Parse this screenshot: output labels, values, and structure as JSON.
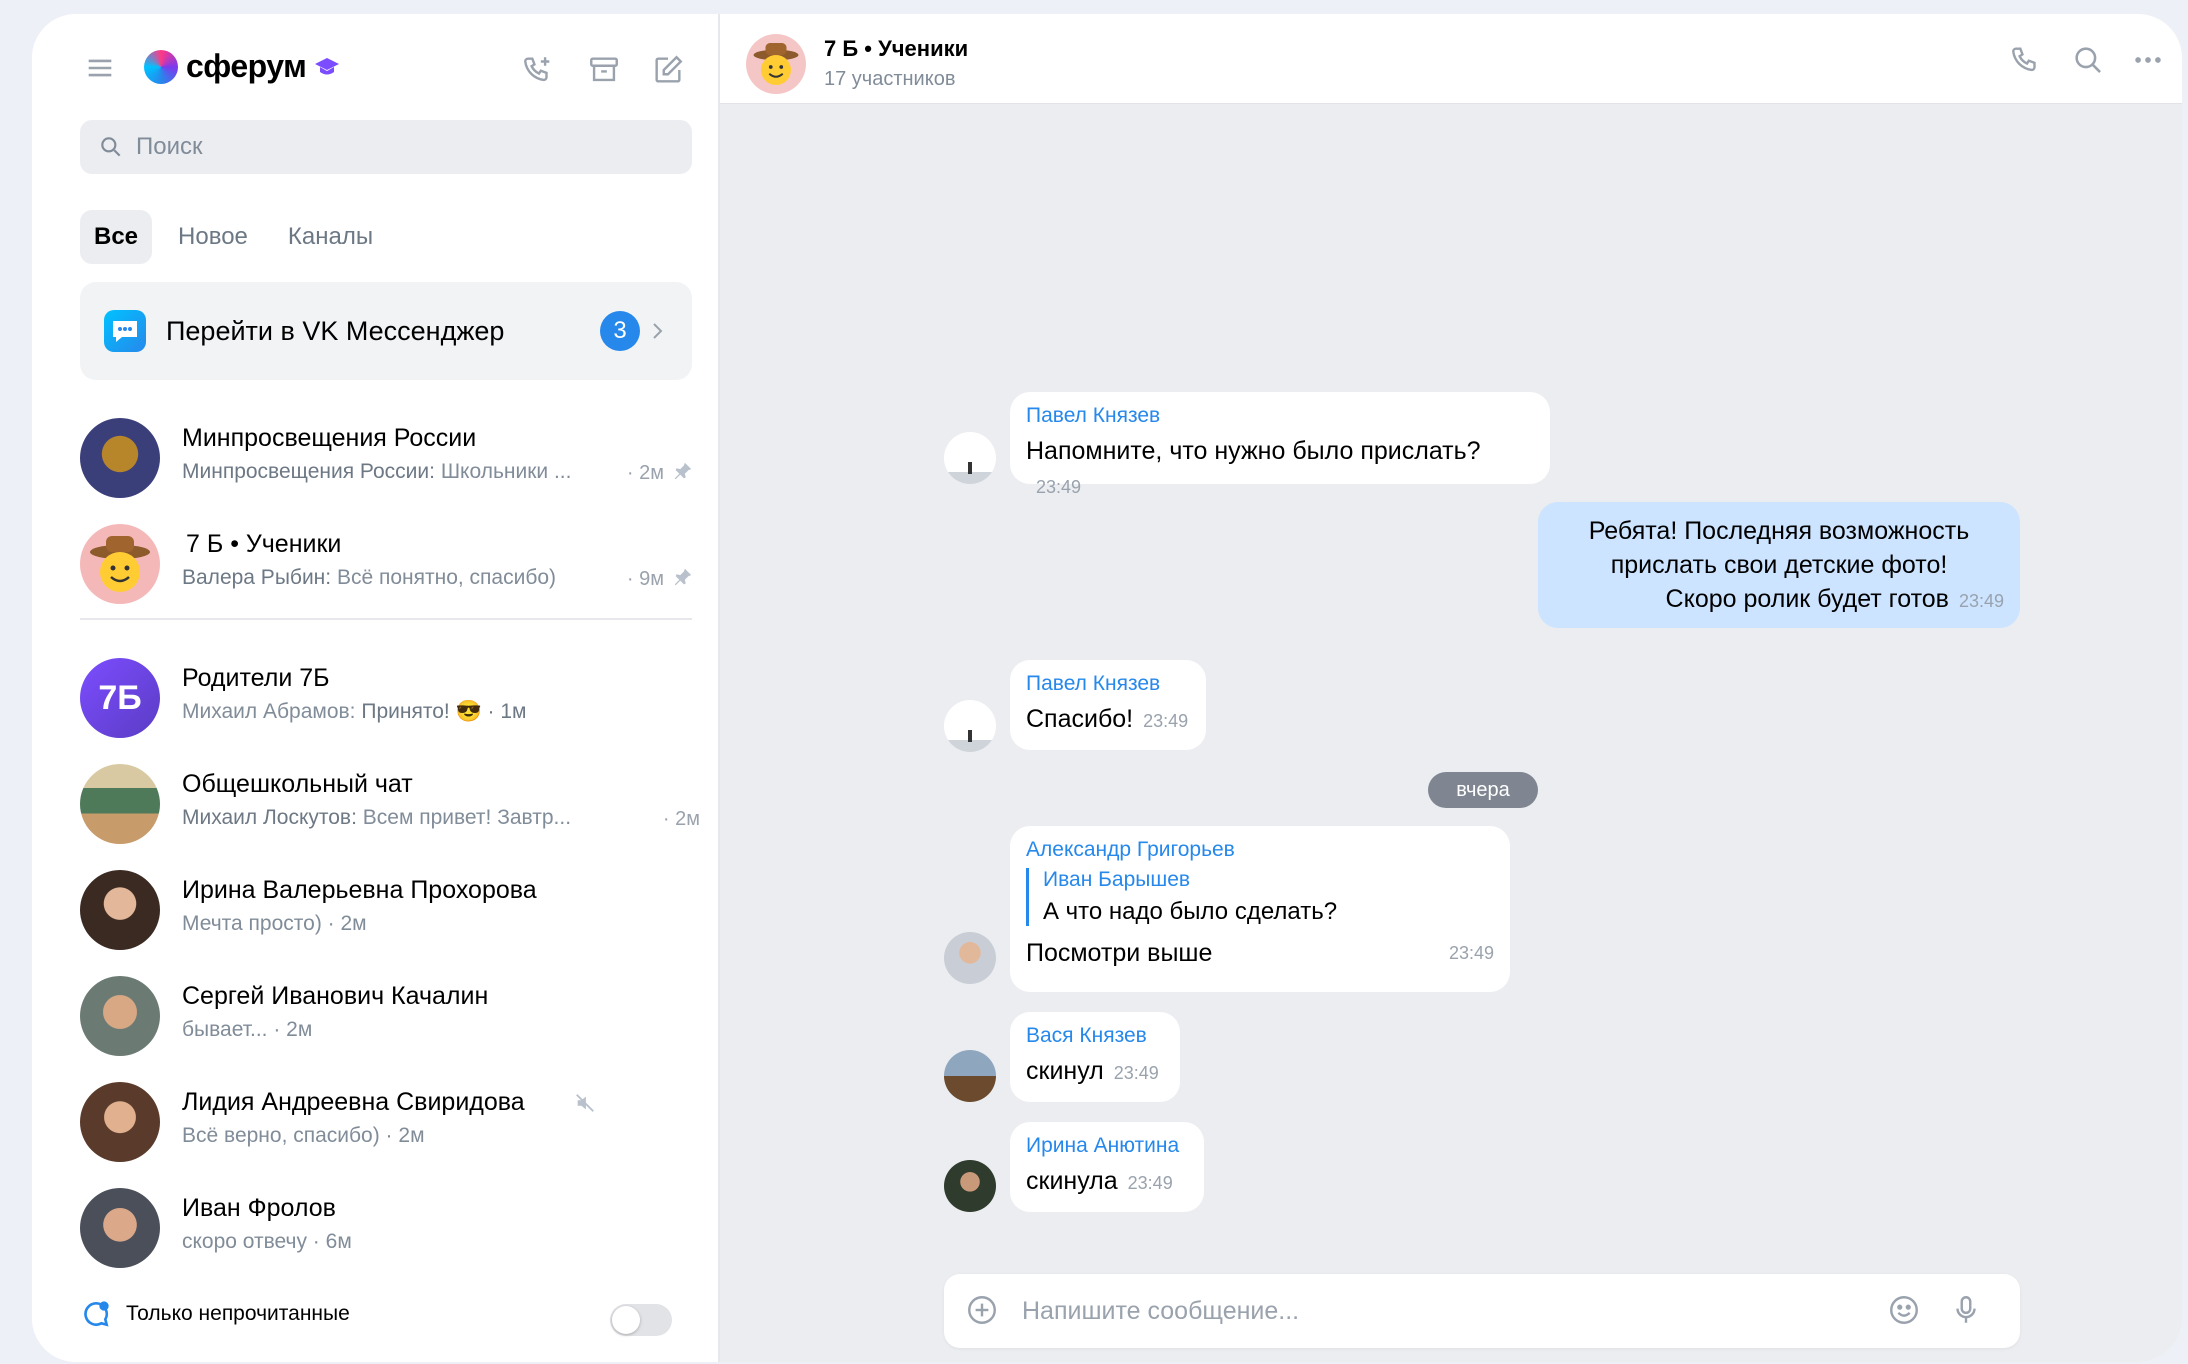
{
  "sidebar": {
    "logo_text": "сферум",
    "search_placeholder": "Поиск",
    "tabs": [
      {
        "label": "Все",
        "active": true
      },
      {
        "label": "Новое",
        "active": false
      },
      {
        "label": "Каналы",
        "active": false
      }
    ],
    "vk_banner": {
      "label": "Перейти в VK Мессенджер",
      "badge": "3"
    },
    "chats": [
      {
        "title": "Минпросвещения России",
        "sender": "Минпросвещения России:",
        "preview": "Школьники ...",
        "time": "· 2м",
        "pinned": true
      },
      {
        "title": "7 Б • Ученики",
        "sender": "Валера Рыбин:",
        "preview": "Всё понятно, спасибо)",
        "time": "· 9м",
        "pinned": true
      },
      {
        "title": "Родители 7Б",
        "sender": "Михаил Абрамов:",
        "preview": "Принято! 😎 · 1м",
        "time": "",
        "pinned": false,
        "avatar_text": "7Б"
      },
      {
        "title": "Общешкольный чат",
        "sender": "Михаил Лоскутов:",
        "preview": "Всем привет! Завтр...",
        "time": "· 2м",
        "pinned": false
      },
      {
        "title": "Ирина Валерьевна Прохорова",
        "sender": "",
        "preview": "Мечта просто) · 2м",
        "time": "",
        "pinned": false
      },
      {
        "title": "Сергей Иванович Качалин",
        "sender": "",
        "preview": "бывает... · 2м",
        "time": "",
        "pinned": false
      },
      {
        "title": "Лидия Андреевна Свиридова",
        "sender": "",
        "preview": "Всё верно, спасибо) · 2м",
        "time": "",
        "pinned": false,
        "muted": true
      },
      {
        "title": "Иван Фролов",
        "sender": "",
        "preview": "скоро отвечу · 6м",
        "time": "",
        "pinned": false
      }
    ],
    "unread_toggle_label": "Только непрочитанные"
  },
  "chat": {
    "title": "7 Б • Ученики",
    "subtitle": "17 участников",
    "date_chip": "вчера",
    "composer_placeholder": "Напишите сообщение...",
    "messages": [
      {
        "name": "Павел Князев",
        "text": "Напомните, что нужно было прислать?",
        "time": "23:49",
        "outgoing": false
      },
      {
        "name": "",
        "lines": [
          "Ребята! Последняя возможность",
          "прислать свои детские фото!",
          "Скоро ролик будет готов"
        ],
        "time": "23:49",
        "outgoing": true
      },
      {
        "name": "Павел Князев",
        "text": "Спасибо!",
        "time": "23:49",
        "outgoing": false
      },
      {
        "name": "Александр Григорьев",
        "reply_name": "Иван Барышев",
        "reply_text": "А что надо было сделать?",
        "text": "Посмотри выше",
        "time": "23:49",
        "outgoing": false
      },
      {
        "name": "Вася Князев",
        "text": "скинул",
        "time": "23:49",
        "outgoing": false
      },
      {
        "name": "Ирина Анютина",
        "text": "скинула",
        "time": "23:49",
        "outgoing": false
      }
    ]
  },
  "colors": {
    "accent": "#2688eb",
    "outgoing_bubble": "#cce4ff",
    "chat_bg": "#ebedf0"
  }
}
